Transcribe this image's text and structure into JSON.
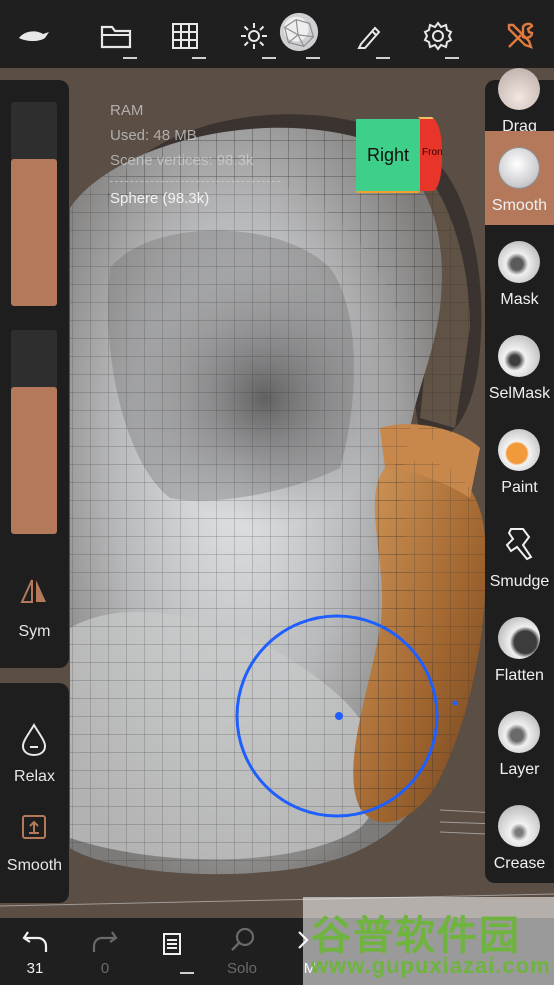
{
  "topbar": {
    "buttons": [
      {
        "name": "logo-button",
        "icon": "sculpt-logo-icon"
      },
      {
        "name": "files-button",
        "icon": "folder-icon"
      },
      {
        "name": "scene-button",
        "icon": "grid-icon"
      },
      {
        "name": "lighting-button",
        "icon": "sun-icon"
      },
      {
        "name": "material-button",
        "icon": "matcap-sphere-icon"
      },
      {
        "name": "brush-settings-button",
        "icon": "pen-icon"
      },
      {
        "name": "settings-button",
        "icon": "gear-icon"
      },
      {
        "name": "tools-button",
        "icon": "wrench-screwdriver-icon"
      }
    ],
    "accent_color": "#e07a3e"
  },
  "left_panel": {
    "radius_slider_value": 0.72,
    "intensity_slider_value": 0.72,
    "sym_label": "Sym",
    "relax_label": "Relax",
    "smooth_label": "Smooth",
    "slider_color": "#b4785a"
  },
  "info": {
    "title": "RAM",
    "used": "Used: 48 MB",
    "vertices": "Scene vertices: 98.3k",
    "mesh": "Sphere (98.3k)"
  },
  "cube": {
    "right": "Right",
    "front": "Front"
  },
  "tools": [
    {
      "label": "Drag",
      "icon": "drag-icon",
      "active": false
    },
    {
      "label": "Smooth",
      "icon": "smooth-icon",
      "active": true
    },
    {
      "label": "Mask",
      "icon": "mask-icon",
      "active": false
    },
    {
      "label": "SelMask",
      "icon": "selmask-icon",
      "active": false
    },
    {
      "label": "Paint",
      "icon": "paint-icon",
      "active": false
    },
    {
      "label": "Smudge",
      "icon": "smudge-icon",
      "active": false
    },
    {
      "label": "Flatten",
      "icon": "flatten-icon",
      "active": false
    },
    {
      "label": "Layer",
      "icon": "layer-icon",
      "active": false
    },
    {
      "label": "Crease",
      "icon": "crease-icon",
      "active": false
    }
  ],
  "bottombar": {
    "undo_count": "31",
    "redo_count": "0",
    "solo_label": "Solo",
    "m_label": "M"
  },
  "watermark": {
    "line1": "谷普软件园",
    "line2": "www.gupuxiazai.com"
  }
}
